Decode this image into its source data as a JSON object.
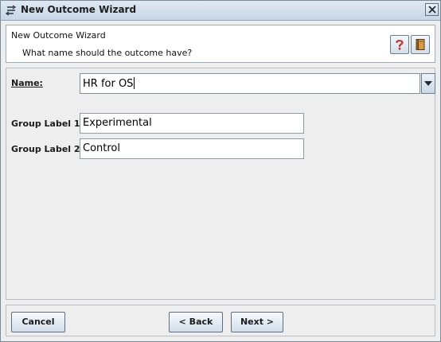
{
  "window": {
    "title": "New Outcome Wizard"
  },
  "header": {
    "title": "New Outcome Wizard",
    "subtitle": "What name should the outcome have?"
  },
  "form": {
    "name_label": "Name:",
    "name_value": "HR for OS",
    "group1_label": "Group Label 1:",
    "group1_value": "Experimental",
    "group2_label": "Group Label 2:",
    "group2_value": "Control"
  },
  "buttons": {
    "cancel": "Cancel",
    "back": "< Back",
    "next": "Next >"
  },
  "icons": {
    "window": "wizard-icon",
    "close": "close-icon",
    "help": "help-icon",
    "book": "book-icon",
    "dropdown": "chevron-down-icon"
  },
  "colors": {
    "titlebar": "#c8d6e6",
    "help_mark": "#c0302a",
    "book": "#b57a2c"
  }
}
